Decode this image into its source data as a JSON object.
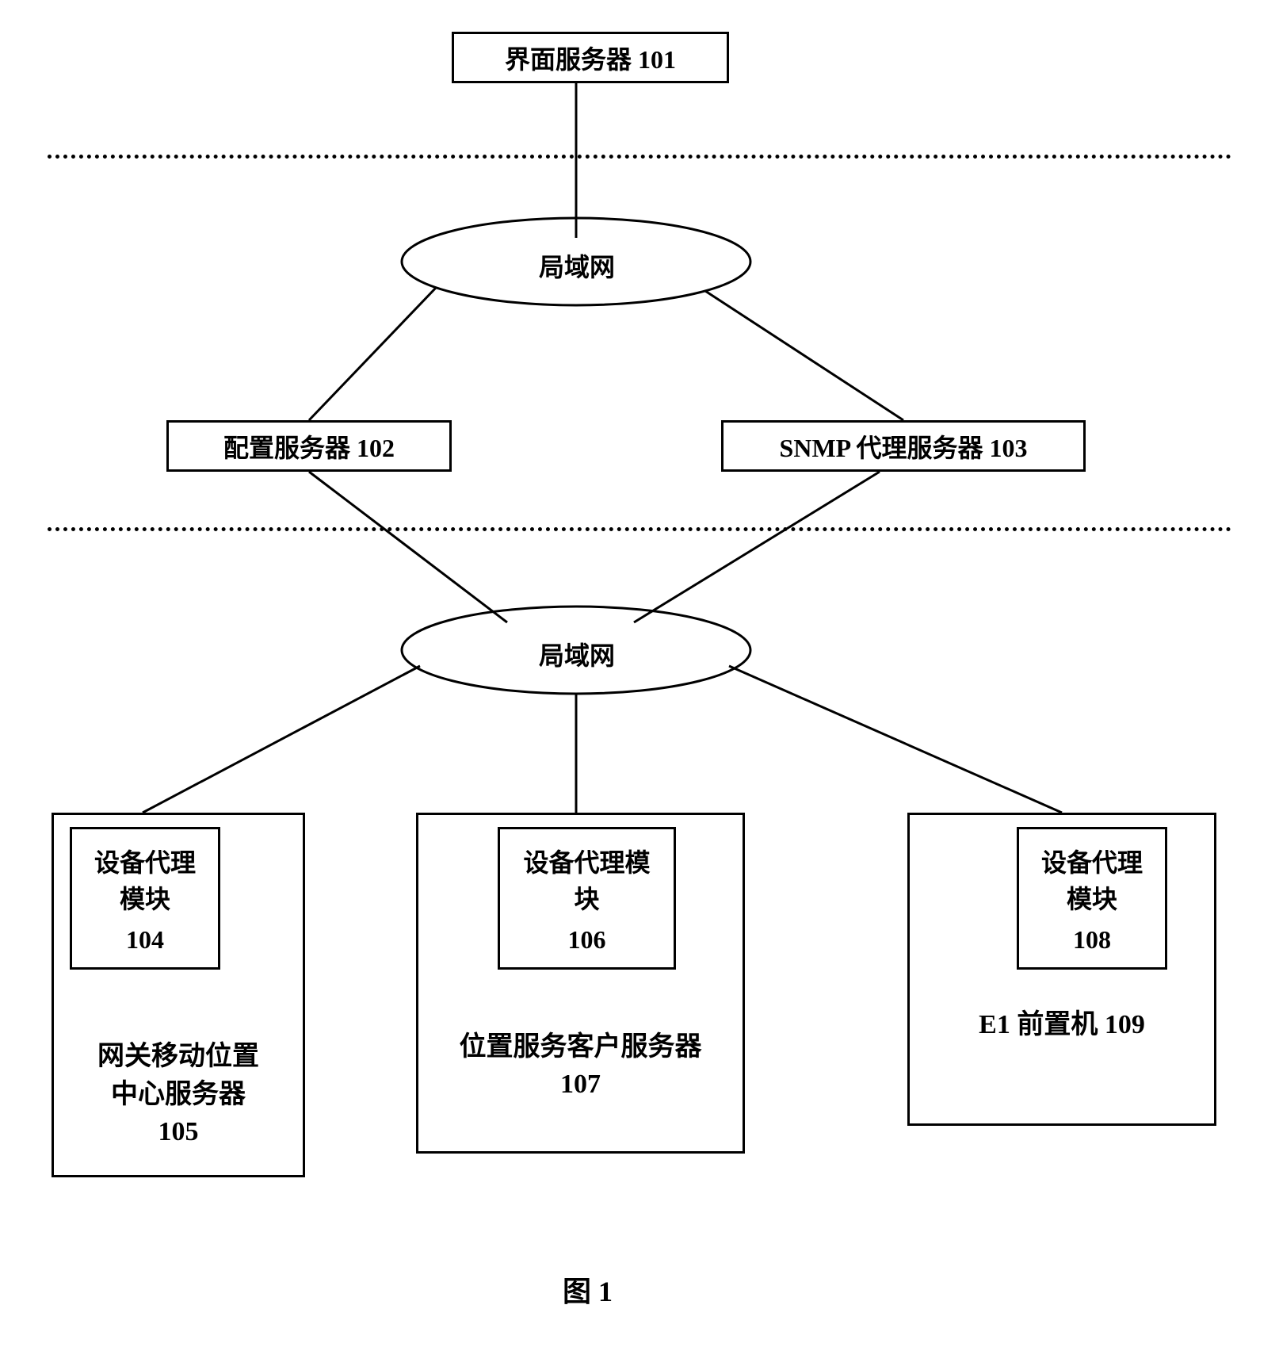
{
  "ui_server": {
    "label": "界面服务器  101"
  },
  "lan1": {
    "label": "局域网"
  },
  "config_server": {
    "label": "配置服务器  102"
  },
  "snmp_server": {
    "label": "SNMP 代理服务器  103"
  },
  "lan2": {
    "label": "局域网"
  },
  "device_agent_104": {
    "line1": "设备代理",
    "line2": "模块",
    "line3": "104"
  },
  "gmlc_server": {
    "line1": "网关移动位置",
    "line2": "中心服务器",
    "line3": "105"
  },
  "device_agent_106": {
    "line1": "设备代理模",
    "line2": "块",
    "line3": "106"
  },
  "lcs_server": {
    "line1": "位置服务客户服务器",
    "line2": "107"
  },
  "device_agent_108": {
    "line1": "设备代理",
    "line2": "模块",
    "line3": "108"
  },
  "e1_server": {
    "line1": "E1 前置机  109"
  },
  "figure_label": "图  1"
}
